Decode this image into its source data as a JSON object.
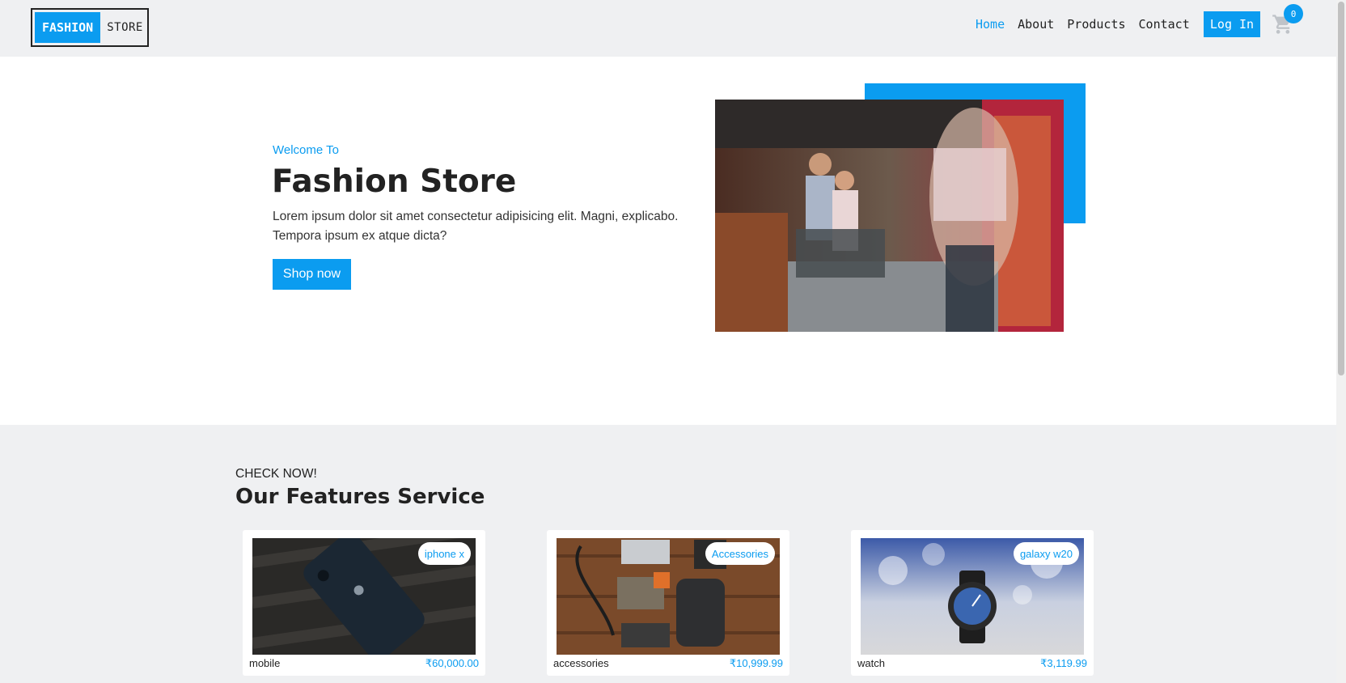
{
  "navbar": {
    "logo_primary": "FASHION",
    "logo_secondary": "STORE",
    "links": [
      "Home",
      "About",
      "Products",
      "Contact"
    ],
    "active_link": "Home",
    "login_label": "Log In",
    "cart_count": "0",
    "cart_icon": "cart-icon"
  },
  "hero": {
    "kicker": "Welcome To",
    "title": "Fashion Store",
    "description": "Lorem ipsum dolor sit amet consectetur adipisicing elit. Magni, explicabo. Tempora ipsum ex atque dicta?",
    "cta_label": "Shop now"
  },
  "features": {
    "kicker": "CHECK NOW!",
    "title": "Our Features Service",
    "cards": [
      {
        "tag": "iphone x",
        "name": "mobile",
        "price": "₹60,000.00"
      },
      {
        "tag": "Accessories",
        "name": "accessories",
        "price": "₹10,999.99"
      },
      {
        "tag": "galaxy w20",
        "name": "watch",
        "price": "₹3,119.99"
      }
    ]
  },
  "colors": {
    "accent": "#0b9cf0",
    "background": "#eff0f2",
    "text": "#222222"
  }
}
